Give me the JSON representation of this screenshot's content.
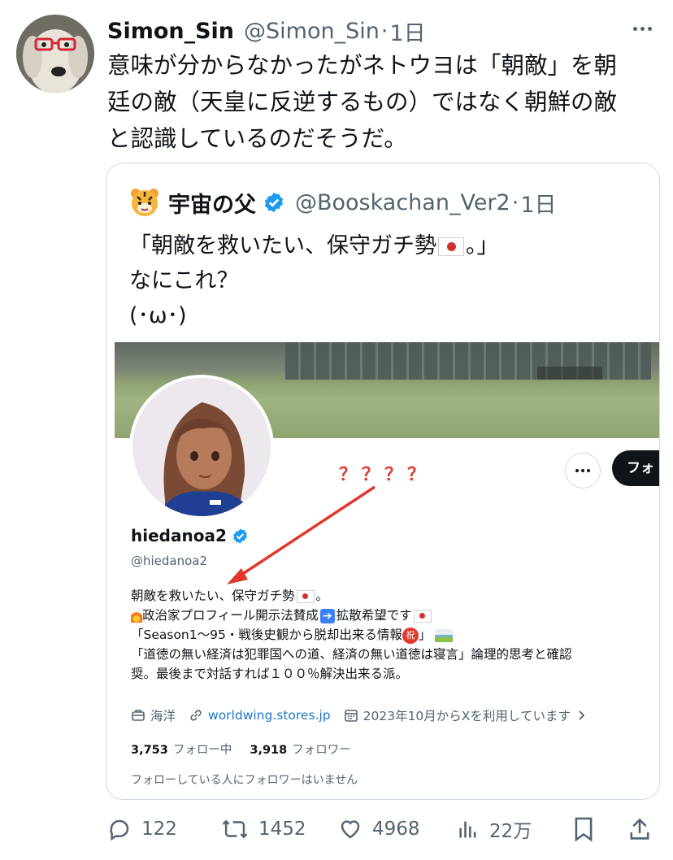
{
  "tweet": {
    "author_name": "Simon_Sin",
    "author_handle": "@Simon_Sin",
    "separator": "·",
    "time": "1日",
    "text_lines": [
      "意味が分からなかったがネトウヨは「朝敵」を朝",
      "廷の敵（天皇に反逆するもの）ではなく朝鮮の敵",
      "と認識しているのだそうだ。"
    ]
  },
  "quote": {
    "author_name": "宇宙の父",
    "author_handle": "@Booskachan_Ver2",
    "separator": "·",
    "time": "1日",
    "line1_a": "「朝敵を救いたい、保守ガチ勢",
    "line1_b": "。」",
    "line2": "なにこれ？",
    "line3": "(･ω･)"
  },
  "profile_screenshot": {
    "annotation": "？？？？",
    "follow_label": "フォ",
    "name": "hiedanoa2",
    "handle": "@hiedanoa2",
    "bio": {
      "l1_a": "朝敵を救いたい、保守ガチ勢",
      "l1_b": "。",
      "l2_a": "政治家プロフィール開示法賛成",
      "l2_b": "拡散希望です",
      "l3_a": "「Season1～95・戦後史観から脱却出来る情報",
      "l3_b": "」",
      "l4": "「道徳の無い経済は犯罪国への道、経済の無い道徳は寝言」論理的思考と確認",
      "l5": "奨。最後まで対話すれば１００％解決出来る派。"
    },
    "iwai_char": "祝",
    "location": "海洋",
    "link": "worldwing.stores.jp",
    "joined": "2023年10月からXを利用しています",
    "following_count": "3,753",
    "following_label": "フォロー中",
    "followers_count": "3,918",
    "followers_label": "フォロワー",
    "note": "フォローしている人にフォロワーはいません"
  },
  "actions": {
    "replies": "122",
    "retweets": "1452",
    "likes": "4968",
    "views": "22万"
  },
  "colors": {
    "text": "#0f1419",
    "secondary": "#536471",
    "border": "#cfd9de",
    "verified": "#1d9bf0",
    "annotation_red": "#e0392c",
    "link": "#1d77c7"
  }
}
